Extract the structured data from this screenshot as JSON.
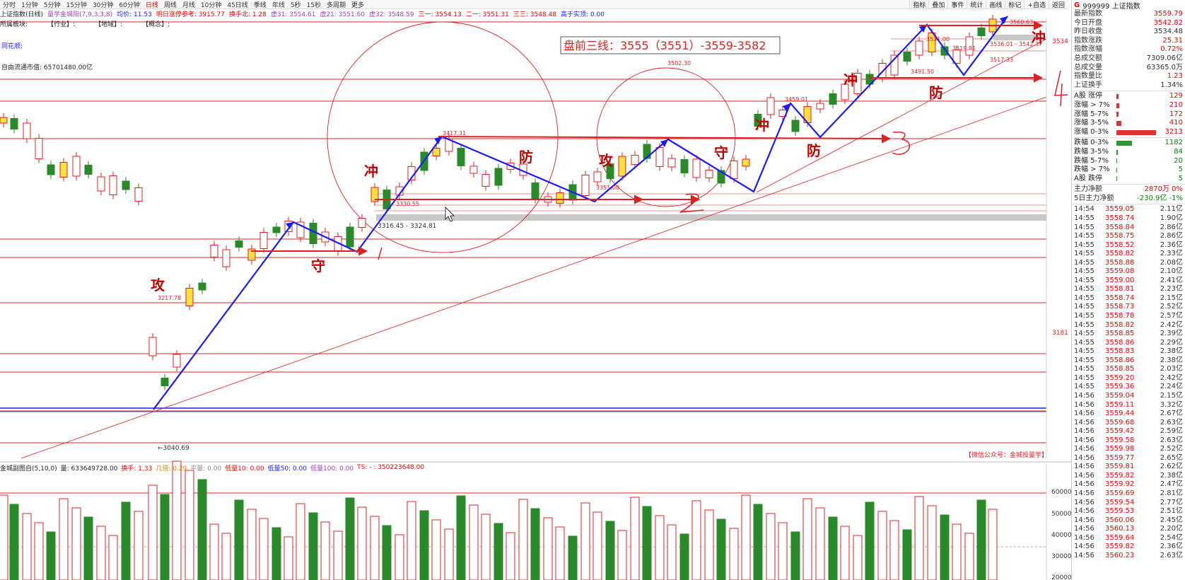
{
  "toolbar": {
    "periods": [
      "分时",
      "1分钟",
      "5分钟",
      "15分钟",
      "30分钟",
      "60分钟",
      "日线",
      "周线",
      "月线",
      "10分钟",
      "45日线",
      "季线",
      "年线",
      "5秒",
      "15秒",
      "多周期",
      "更多"
    ],
    "active_period": "日线",
    "right_buttons": [
      "指标",
      "叠加",
      "事件",
      "统计",
      "画线",
      "标记",
      "+自选",
      "返回"
    ]
  },
  "info": {
    "index_name": "上证指数(日线)",
    "indicator": "量学金城阳(7,9,3,3,8)",
    "avg": "均价: 11.53",
    "limit_ref": "明日涨停参考: 3915.77",
    "turnover_ratio": "换手北: 1.28",
    "v31": "虚31: 3554.61",
    "v21": "虚21: 3551.60",
    "v32": "虚32: 3548.59",
    "s31": "三一: 3554.13",
    "s21": "二一: 3551.31",
    "s3": "三三: 3548.48",
    "real": "高于实顶: 0.00"
  },
  "sectors": {
    "label": "所属板块:",
    "industry": "【行业】:",
    "region": "【地域】:",
    "concept": "【概念】:"
  },
  "tonghuashun": "同花顺:",
  "float_mv": "自由流通市值: 65701480.00亿",
  "plan_box": "盘前三线：3555（3551）-3559-3582",
  "annotations": {
    "gong": "攻",
    "shou": "守",
    "chong": "冲",
    "fang": "防"
  },
  "price_labels": {
    "p3040": "←3040.69",
    "p3217": "3217.78",
    "p3316": "3316.45 - 3324.81",
    "p3417": "3417.31",
    "p3502": "3502.30",
    "p3351": "3351.00",
    "p3330": "3330.55",
    "p3459": "3459.01",
    "p3491": "3491.50",
    "p3519": "3519.81",
    "p3536": "3536.01 - 3542.37",
    "p3517": "3517.33",
    "p3560": "3560.63",
    "p3531": "3531.00"
  },
  "y_axis": [
    "3534",
    "3181"
  ],
  "vol_axis": [
    "60000",
    "50000",
    "40000",
    "30000",
    "20000"
  ],
  "wechat": "【微信公众号：金城投量学】",
  "vol_info": {
    "name": "金城副图自(5,10,0)",
    "vol": "量: 633649728.00",
    "hs": "换手: 1.33",
    "jb": "几倍: 0.29",
    "pl": "平量: 0.00",
    "d10": "低量10: 0.00",
    "d50": "低量50: 0.00",
    "d100": "低量100: 0.00",
    "ts": "TS: - : 350223648.00"
  },
  "right_panel": {
    "code": "999999 上证指数",
    "badge": "G",
    "quote": [
      {
        "label": "最新指数",
        "value": "3559.79",
        "color": "#e00"
      },
      {
        "label": "今日开盘",
        "value": "3542.82",
        "color": "#e00"
      },
      {
        "label": "昨日收盘",
        "value": "3534.48",
        "color": "#333"
      },
      {
        "label": "指数涨跌",
        "value": "25.31",
        "color": "#e00"
      },
      {
        "label": "指数涨幅",
        "value": "0.72%",
        "color": "#e00"
      },
      {
        "label": "总成交额",
        "value": "7309.06亿",
        "color": "#333"
      },
      {
        "label": "总成交量",
        "value": "63365.0万",
        "color": "#333"
      },
      {
        "label": "指数量比",
        "value": "1.23",
        "color": "#e00"
      },
      {
        "label": "上证换手",
        "value": "1.34%",
        "color": "#333"
      }
    ],
    "breadth_up": [
      {
        "label": "A股 涨停",
        "value": "129",
        "width": 3
      },
      {
        "label": "涨幅 > 7%",
        "value": "210",
        "width": 4
      },
      {
        "label": "涨幅 5-7%",
        "value": "172",
        "width": 3
      },
      {
        "label": "涨幅 3-5%",
        "value": "410",
        "width": 7
      },
      {
        "label": "涨幅 0-3%",
        "value": "3213",
        "width": 56
      }
    ],
    "breadth_down": [
      {
        "label": "跌幅 0-3%",
        "value": "1182",
        "width": 22
      },
      {
        "label": "跌幅 3-5%",
        "value": "84",
        "width": 2
      },
      {
        "label": "跌幅 5-7%",
        "value": "20",
        "width": 1
      },
      {
        "label": "跌幅 > 7%",
        "value": "5",
        "width": 1
      },
      {
        "label": "A股 跌停",
        "value": "5",
        "width": 1
      }
    ],
    "capital": [
      {
        "label": "主力净额",
        "value": "2870万",
        "pct": "0%",
        "color": "#e00"
      },
      {
        "label": "5日主力净额",
        "value": "-230.9亿",
        "pct": "-1%",
        "color": "#080"
      }
    ],
    "ticks": [
      [
        "14:54",
        "3559.05",
        "2.11亿"
      ],
      [
        "14:55",
        "3558.74",
        "1.90亿"
      ],
      [
        "14:55",
        "3558.84",
        "2.86亿"
      ],
      [
        "14:55",
        "3558.75",
        "2.86亿"
      ],
      [
        "14:55",
        "3558.52",
        "2.36亿"
      ],
      [
        "14:55",
        "3558.82",
        "2.33亿"
      ],
      [
        "14:55",
        "3558.88",
        "2.08亿"
      ],
      [
        "14:55",
        "3559.08",
        "2.10亿"
      ],
      [
        "14:55",
        "3559.00",
        "2.41亿"
      ],
      [
        "14:55",
        "3558.81",
        "2.23亿"
      ],
      [
        "14:55",
        "3558.74",
        "2.15亿"
      ],
      [
        "14:55",
        "3558.73",
        "2.52亿"
      ],
      [
        "14:55",
        "3558.78",
        "2.57亿"
      ],
      [
        "14:55",
        "3558.82",
        "2.42亿"
      ],
      [
        "14:55",
        "3558.85",
        "2.39亿"
      ],
      [
        "14:55",
        "3558.86",
        "2.29亿"
      ],
      [
        "14:55",
        "3558.83",
        "2.38亿"
      ],
      [
        "14:55",
        "3558.86",
        "2.38亿"
      ],
      [
        "14:55",
        "3558.85",
        "2.03亿"
      ],
      [
        "14:55",
        "3559.20",
        "2.42亿"
      ],
      [
        "14:55",
        "3559.36",
        "2.24亿"
      ],
      [
        "14:56",
        "3559.04",
        "2.15亿"
      ],
      [
        "14:56",
        "3559.11",
        "3.32亿"
      ],
      [
        "14:56",
        "3559.44",
        "2.67亿"
      ],
      [
        "14:56",
        "3559.68",
        "2.63亿"
      ],
      [
        "14:56",
        "3559.42",
        "2.59亿"
      ],
      [
        "14:56",
        "3559.58",
        "2.63亿"
      ],
      [
        "14:56",
        "3559.98",
        "2.52亿"
      ],
      [
        "14:56",
        "3559.77",
        "2.65亿"
      ],
      [
        "14:56",
        "3559.81",
        "2.62亿"
      ],
      [
        "14:56",
        "3559.82",
        "2.38亿"
      ],
      [
        "14:56",
        "3559.92",
        "2.47亿"
      ],
      [
        "14:56",
        "3559.69",
        "2.81亿"
      ],
      [
        "14:56",
        "3559.54",
        "2.77亿"
      ],
      [
        "14:56",
        "3559.53",
        "2.51亿"
      ],
      [
        "14:56",
        "3560.06",
        "2.45亿"
      ],
      [
        "14:56",
        "3560.13",
        "2.20亿"
      ],
      [
        "14:56",
        "3559.64",
        "2.54亿"
      ],
      [
        "14:56",
        "3559.82",
        "2.36亿"
      ],
      [
        "14:56",
        "3560.23",
        "2.63亿"
      ]
    ]
  }
}
